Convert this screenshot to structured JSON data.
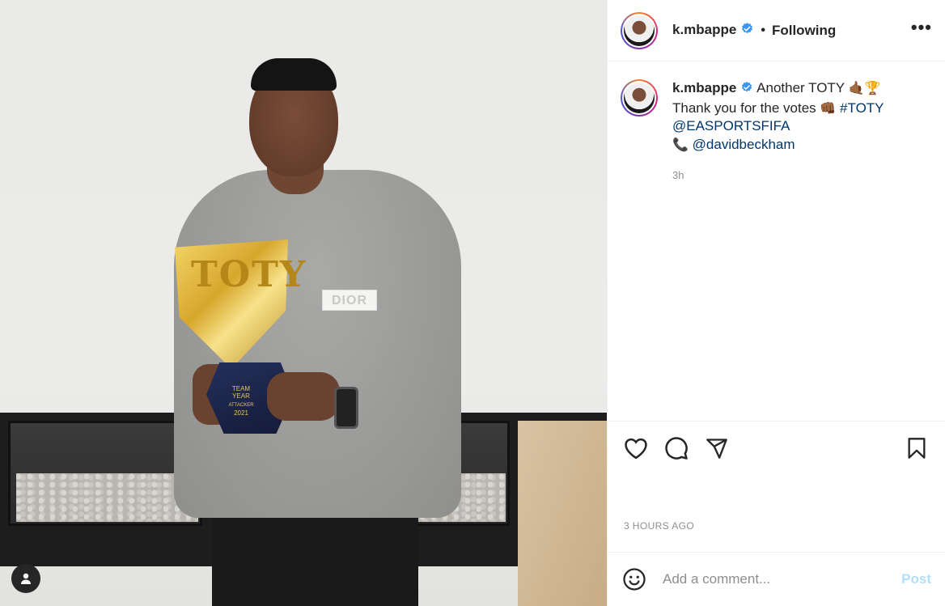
{
  "post": {
    "photo": {
      "patch_text": "DIOR",
      "trophy_letters": "TOTY",
      "trophy_base_line1": "TEAM",
      "trophy_base_line2": "YEAR",
      "trophy_base_line3": "ATTACKER",
      "trophy_base_line4": "2021"
    },
    "header": {
      "username": "k.mbappe",
      "separator": "•",
      "follow_status": "Following",
      "more_label": "•••"
    },
    "caption": {
      "username": "k.mbappe",
      "line1_text": "Another TOTY",
      "line1_emoji": "🤙🏾🏆",
      "line2_text": "Thank you for the votes",
      "line2_emoji": "👊🏾",
      "hashtag": "#TOTY",
      "mention1": "@EASPORTSFIFA",
      "line4_emoji": "📞",
      "mention2": "@davidbeckham",
      "time_ago": "3h"
    },
    "timestamp": "3 HOURS AGO",
    "comment": {
      "placeholder": "Add a comment...",
      "post_label": "Post"
    },
    "icons": {
      "like": "heart-icon",
      "comment": "comment-icon",
      "share": "share-icon",
      "save": "bookmark-icon",
      "emoji": "smiley-icon",
      "tags": "user-tag-icon",
      "verified": "verified-badge-icon"
    },
    "colors": {
      "link": "#00376b",
      "post_disabled": "#b2dffc",
      "verified": "#3897f0",
      "muted": "#8e8e8e"
    }
  }
}
